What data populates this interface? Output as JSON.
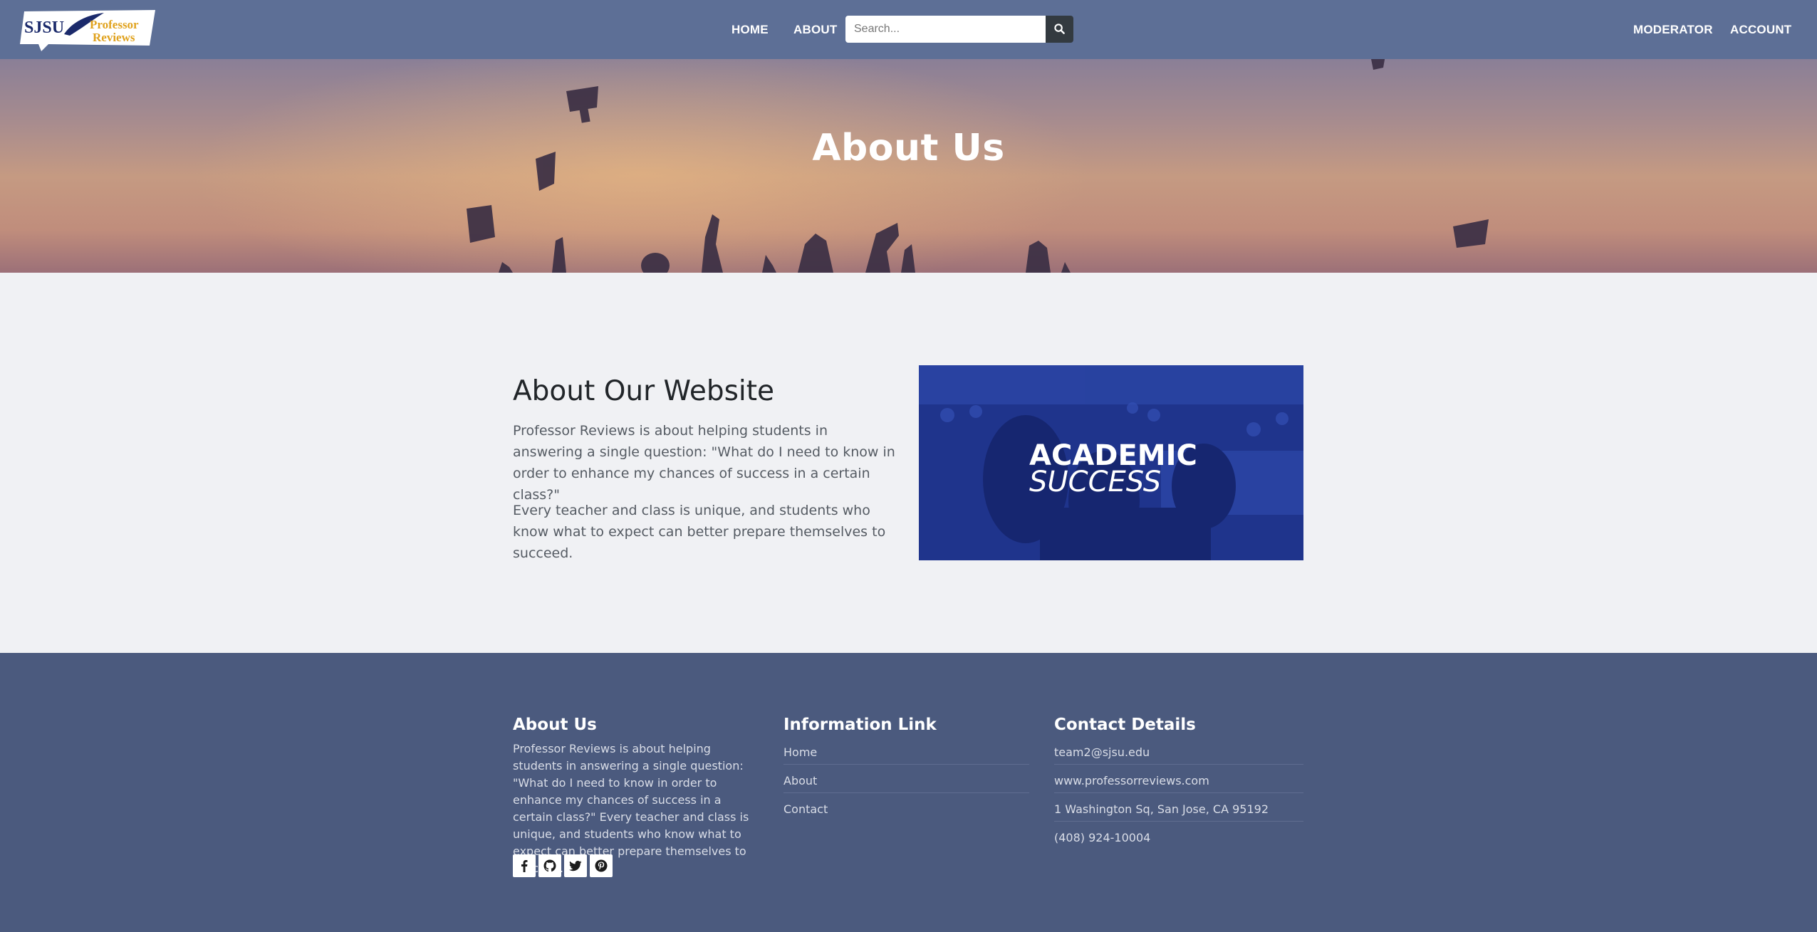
{
  "nav": {
    "logo_text_sjsu": "SJSU",
    "logo_text_professor": "Professor",
    "logo_text_reviews": "Reviews",
    "home": "HOME",
    "about": "ABOUT",
    "search_placeholder": "Search...",
    "moderator": "MODERATOR",
    "account": "ACCOUNT"
  },
  "hero": {
    "title": "About Us"
  },
  "about": {
    "heading": "About Our Website",
    "paragraph_1": "Professor Reviews is about helping students in answering a single question: \"What do I need to know in order to enhance my chances of success in a certain class?\"",
    "paragraph_2": "Every teacher and class is unique, and students who know what to expect can better prepare themselves to succeed.",
    "image_text_line1": "ACADEMIC",
    "image_text_line2": "SUCCESS"
  },
  "footer": {
    "about_title": "About Us",
    "about_text": "Professor Reviews is about helping students in answering a single question: \"What do I need to know in order to enhance my chances of success in a certain class?\" Every teacher and class is unique, and students who know what to expect can better prepare themselves to succeed.",
    "social_icons": [
      "facebook-icon",
      "github-icon",
      "twitter-icon",
      "pinterest-icon"
    ],
    "info_title": "Information Link",
    "info_links": [
      "Home",
      "About",
      "Contact"
    ],
    "contact_title": "Contact Details",
    "contact_items": [
      "team2@sjsu.edu",
      "www.professorreviews.com",
      "1 Washington Sq, San Jose, CA 95192",
      "(408) 924-10004"
    ]
  },
  "colors": {
    "navbar": "#5d6f96",
    "footer": "#4b5a7e",
    "page_bg": "#f0f1f4",
    "search_button": "#333a40",
    "image_overlay": "#1f348c",
    "logo_gold": "#e0a21e",
    "logo_navy": "#1b2a6b"
  }
}
